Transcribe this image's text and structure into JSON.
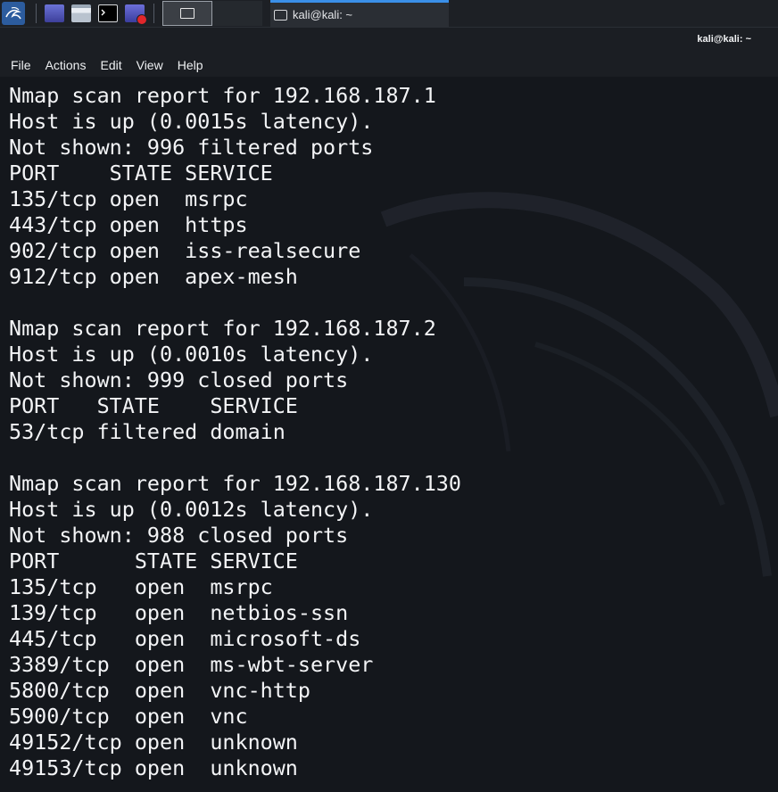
{
  "taskbar": {
    "icons": [
      "kali-menu-icon",
      "desktop-icon",
      "file-manager-icon",
      "terminal-icon",
      "screen-recorder-icon"
    ],
    "active_task": "kali@kali: ~",
    "accent_color": "#3a8fe8"
  },
  "window": {
    "title": "kali@kali: ~"
  },
  "menu": {
    "file": "File",
    "actions": "Actions",
    "edit": "Edit",
    "view": "View",
    "help": "Help"
  },
  "terminal": {
    "lines": [
      "Nmap scan report for 192.168.187.1",
      "Host is up (0.0015s latency).",
      "Not shown: 996 filtered ports",
      "PORT    STATE SERVICE",
      "135/tcp open  msrpc",
      "443/tcp open  https",
      "902/tcp open  iss-realsecure",
      "912/tcp open  apex-mesh",
      "",
      "Nmap scan report for 192.168.187.2",
      "Host is up (0.0010s latency).",
      "Not shown: 999 closed ports",
      "PORT   STATE    SERVICE",
      "53/tcp filtered domain",
      "",
      "Nmap scan report for 192.168.187.130",
      "Host is up (0.0012s latency).",
      "Not shown: 988 closed ports",
      "PORT      STATE SERVICE",
      "135/tcp   open  msrpc",
      "139/tcp   open  netbios-ssn",
      "445/tcp   open  microsoft-ds",
      "3389/tcp  open  ms-wbt-server",
      "5800/tcp  open  vnc-http",
      "5900/tcp  open  vnc",
      "49152/tcp open  unknown",
      "49153/tcp open  unknown"
    ]
  }
}
